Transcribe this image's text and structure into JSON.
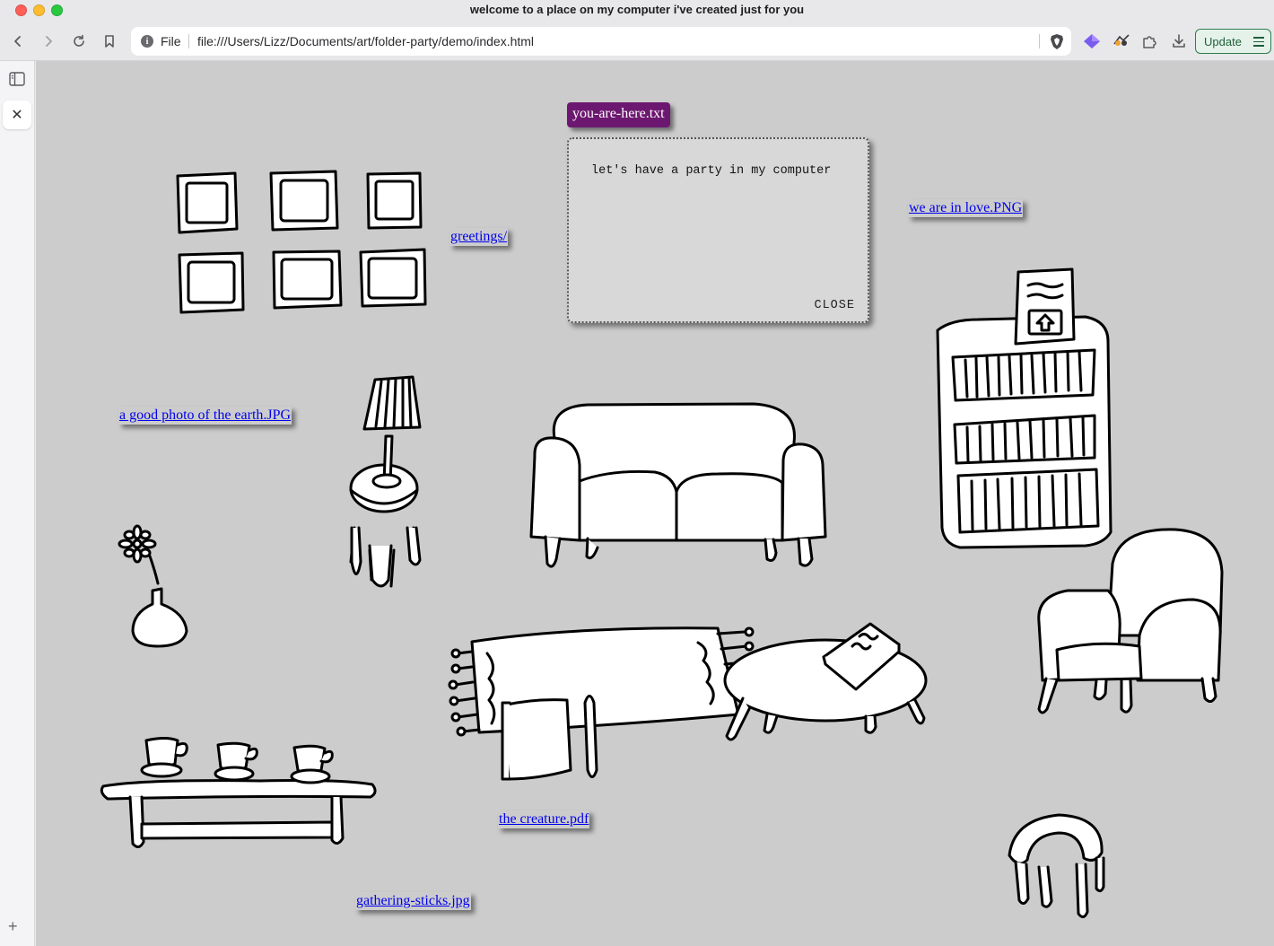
{
  "window": {
    "title": "welcome to a place on my computer i've created just for you"
  },
  "toolbar": {
    "url_scheme": "File",
    "url": "file:///Users/Lizz/Documents/art/folder-party/demo/index.html",
    "update_label": "Update"
  },
  "sidebar": {
    "close_tab_glyph": "✕",
    "add_glyph": "+"
  },
  "note": {
    "title": "you-are-here.txt",
    "text": "let's have a party in my computer",
    "close_label": "CLOSE"
  },
  "links": {
    "greetings": "greetings/",
    "love": "we are in love.PNG",
    "earth": "a good photo of the earth.JPG",
    "creature": "the creature.pdf",
    "sticks": "gathering-sticks.jpg"
  },
  "icons": [
    "back-icon",
    "forward-icon",
    "reload-icon",
    "bookmark-icon",
    "info-icon",
    "brave-shield-icon",
    "rewards-icon",
    "wallet-icon",
    "extensions-icon",
    "download-icon",
    "menu-icon",
    "sidebar-toggle-icon",
    "close-tab-icon",
    "add-tab-icon"
  ],
  "colors": {
    "page_bg": "#cccccc",
    "note_title_bg": "#6d1870",
    "link": "#0000ee",
    "update_accent": "#2e7d4f"
  }
}
